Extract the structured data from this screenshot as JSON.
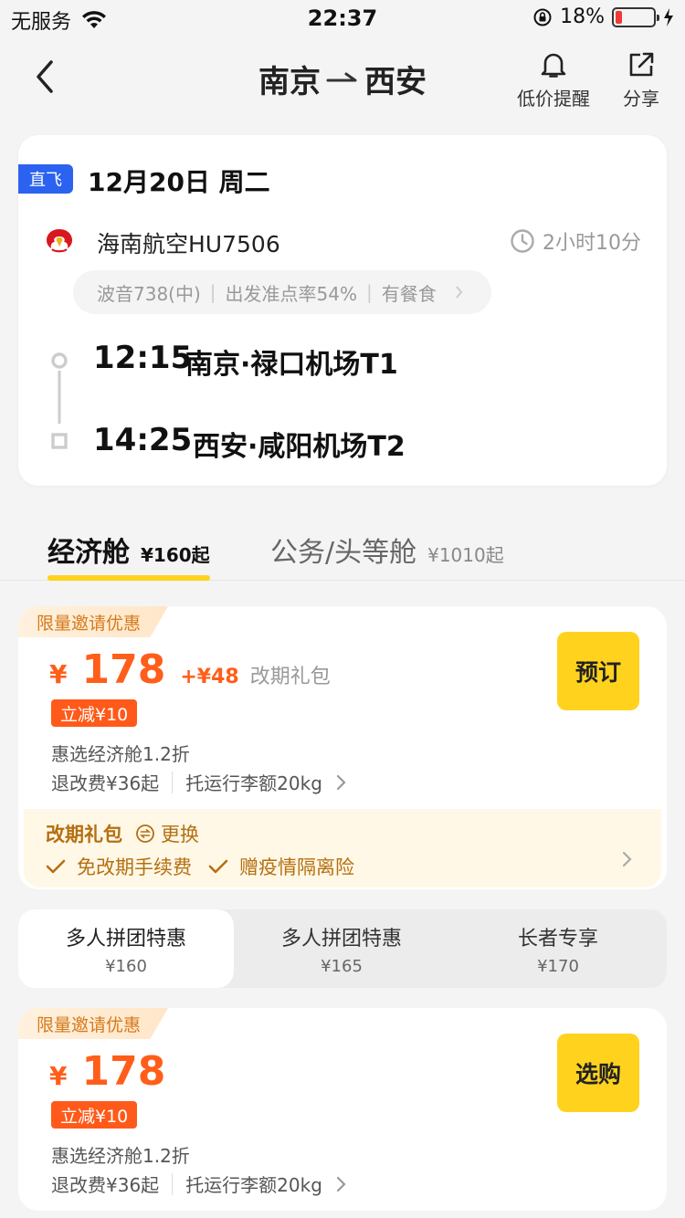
{
  "status_bar": {
    "carrier": "无服务",
    "time": "22:37",
    "battery": "18%",
    "battery_level": 0.18,
    "icons": [
      "wifi-icon",
      "orientation-lock-icon",
      "battery-icon",
      "charging-icon"
    ]
  },
  "nav": {
    "route_from": "南京",
    "route_to": "西安",
    "price_alert": "低价提醒",
    "share": "分享",
    "icons": [
      "back-chevron-icon",
      "bell-icon",
      "share-icon"
    ]
  },
  "flight": {
    "direct_badge": "直飞",
    "date": "12月20日 周二",
    "airline": "海南航空HU7506",
    "duration": "2小时10分",
    "aircraft": "波音738(中)",
    "ontime": "出发准点率54%",
    "meal": "有餐食",
    "departure": {
      "time": "12:15",
      "airport": "南京·禄口机场T1"
    },
    "arrival": {
      "time": "14:25",
      "airport": "西安·咸阳机场T2"
    }
  },
  "cabins": [
    {
      "name": "经济舱",
      "price": "¥160起",
      "active": true
    },
    {
      "name": "公务/头等舱",
      "price": "¥1010起",
      "active": false
    }
  ],
  "offers": [
    {
      "badge": "限量邀请优惠",
      "yen": "¥",
      "price": "178",
      "addon": "+¥48",
      "addon_desc": "改期礼包",
      "discount": "立减¥10",
      "fare": "惠选经济舱1.2折",
      "refund": "退改费¥36起",
      "baggage": "托运行李额20kg",
      "button": "预订",
      "gift": {
        "title": "改期礼包",
        "change": "更换",
        "items": [
          "免改期手续费",
          "赠疫情隔离险"
        ]
      }
    },
    {
      "badge": "限量邀请优惠",
      "yen": "¥",
      "price": "178",
      "discount": "立减¥10",
      "fare": "惠选经济舱1.2折",
      "refund": "退改费¥36起",
      "baggage": "托运行李额20kg",
      "button": "选购"
    }
  ],
  "group_tabs": [
    {
      "name": "多人拼团特惠",
      "price": "¥160",
      "active": true
    },
    {
      "name": "多人拼团特惠",
      "price": "¥165",
      "active": false
    },
    {
      "name": "长者专享",
      "price": "¥170",
      "active": false
    }
  ],
  "colors": {
    "accent_yellow": "#ffd21e",
    "price_orange": "#ff5e1a",
    "direct_blue": "#2c62f0",
    "gift_brown": "#b56f12",
    "gift_bg": "#fff8e6"
  }
}
